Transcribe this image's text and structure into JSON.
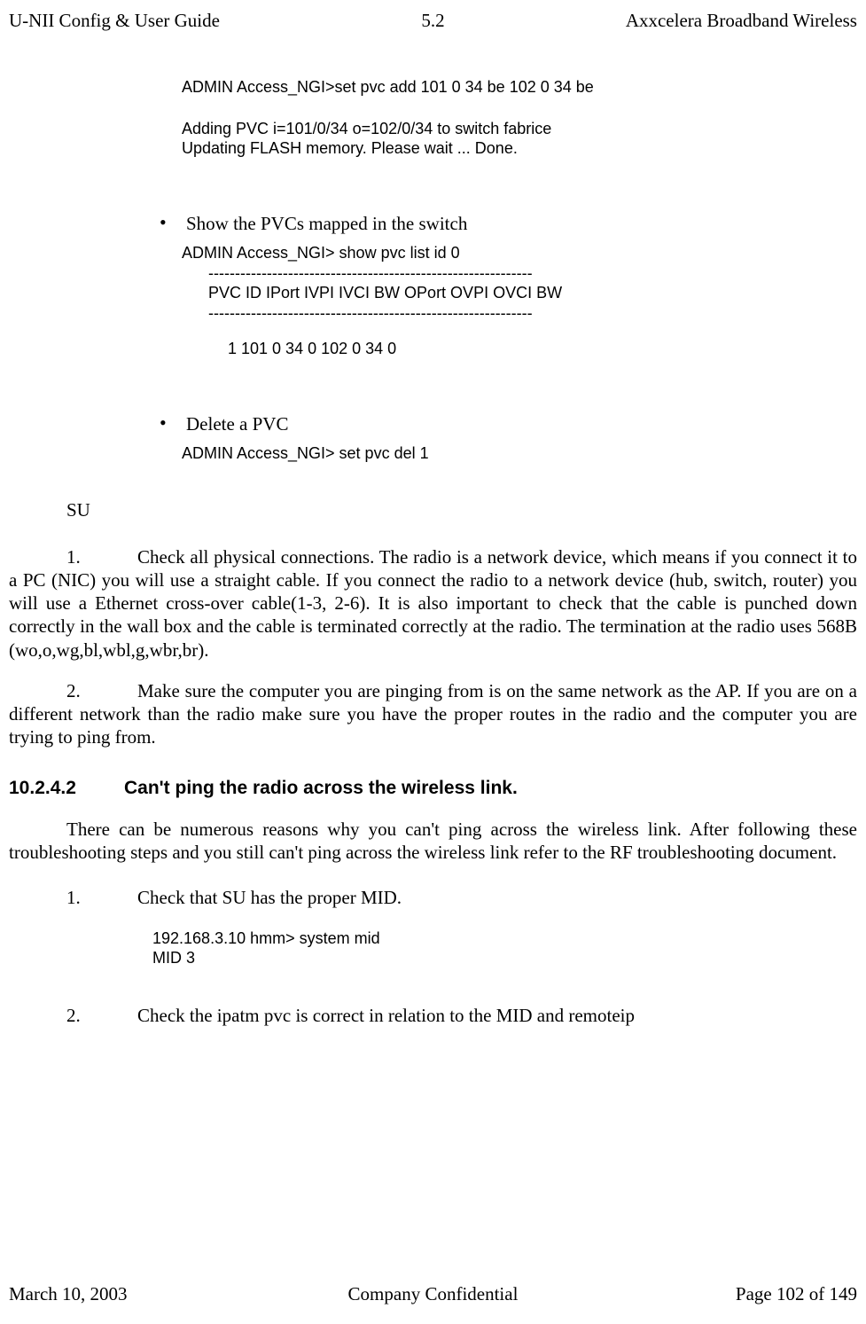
{
  "header": {
    "left": "U-NII Config & User Guide",
    "center": "5.2",
    "right": "Axxcelera Broadband Wireless"
  },
  "cmd1_line": "ADMIN Access_NGI>set   pvc   add   101   0   34   be   102   0   34   be",
  "cmd1_out1": "Adding PVC i=101/0/34 o=102/0/34  to switch fabrice",
  "cmd1_out2": " Updating FLASH memory. Please wait ... Done.",
  "bullet1": "Show the PVCs mapped in the switch",
  "cmd2_line": "ADMIN Access_NGI>   show   pvc   list   id   0",
  "dash1": "-------------------------------------------------------------",
  "hdr_row": "PVC ID  IPort   IVPI   IVCI    BW    OPort  OVPI   OVCI    BW",
  "dash2": "-------------------------------------------------------------",
  "data_row": "1       101     0        34       0       102      0          34        0",
  "bullet2": "Delete a PVC",
  "cmd3_line": "ADMIN Access_NGI>   set   pvc   del   1",
  "su": "SU",
  "p1_num": "1.",
  "p1_text": "Check all physical connections. The radio is a network device, which means if you connect it to a PC (NIC) you will use a straight cable. If you connect the radio to a network device (hub, switch, router) you will use a Ethernet cross-over cable(1-3, 2-6). It is also important to check that the cable is punched down correctly in the wall box and the cable is terminated correctly at the radio. The termination at the radio uses 568B (wo,o,wg,bl,wbl,g,wbr,br).",
  "p2_num": "2.",
  "p2_text": "Make sure the computer you are pinging from is on the same network as the AP. If you are on a different network than the radio make sure you have the proper routes in the radio and the computer you are trying to ping from.",
  "h3_num": "10.2.4.2",
  "h3_text": "Can't ping the radio across the wireless link.",
  "p3_text": "There can be numerous reasons why you can't ping across the wireless link. After following these troubleshooting steps and you still can't ping across the wireless link refer to the RF troubleshooting document.",
  "l1_num": "1.",
  "l1_text": "Check that SU has the proper MID.",
  "l1_code1": "192.168.3.10 hmm> system mid",
  "l1_code2": "MID 3",
  "l2_num": "2.",
  "l2_text": "Check the ipatm pvc is correct in relation to the MID and remoteip",
  "footer": {
    "left": "March 10, 2003",
    "center": "Company Confidential",
    "right": "Page 102 of 149"
  },
  "chart_data": {
    "type": "table",
    "title": "show pvc list id 0",
    "columns": [
      "PVC ID",
      "IPort",
      "IVPI",
      "IVCI",
      "BW",
      "OPort",
      "OVPI",
      "OVCI",
      "BW"
    ],
    "rows": [
      [
        1,
        101,
        0,
        34,
        0,
        102,
        0,
        34,
        0
      ]
    ]
  }
}
